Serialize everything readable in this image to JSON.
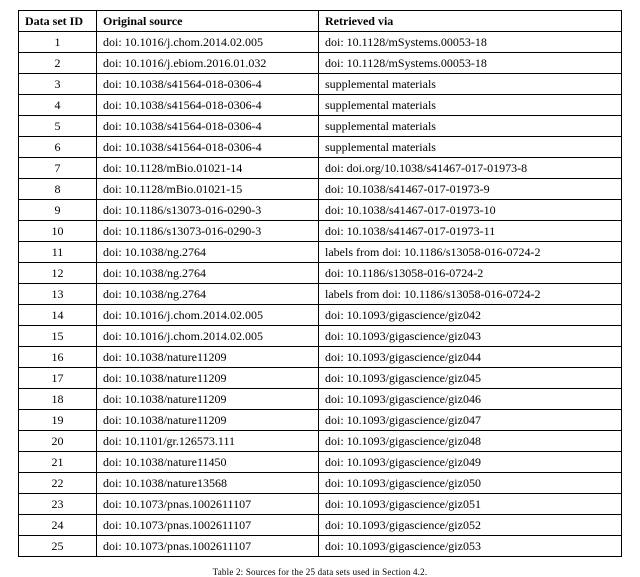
{
  "headers": {
    "id": "Data set ID",
    "src": "Original source",
    "via": "Retrieved via"
  },
  "rows": [
    {
      "id": "1",
      "src": "doi: 10.1016/j.chom.2014.02.005",
      "via": "doi: 10.1128/mSystems.00053-18"
    },
    {
      "id": "2",
      "src": "doi: 10.1016/j.ebiom.2016.01.032",
      "via": "doi: 10.1128/mSystems.00053-18"
    },
    {
      "id": "3",
      "src": "doi: 10.1038/s41564-018-0306-4",
      "via": "supplemental materials"
    },
    {
      "id": "4",
      "src": "doi: 10.1038/s41564-018-0306-4",
      "via": "supplemental materials"
    },
    {
      "id": "5",
      "src": "doi: 10.1038/s41564-018-0306-4",
      "via": "supplemental materials"
    },
    {
      "id": "6",
      "src": "doi: 10.1038/s41564-018-0306-4",
      "via": "supplemental materials"
    },
    {
      "id": "7",
      "src": "doi: 10.1128/mBio.01021-14",
      "via": "doi: doi.org/10.1038/s41467-017-01973-8"
    },
    {
      "id": "8",
      "src": "doi: 10.1128/mBio.01021-15",
      "via": "doi: 10.1038/s41467-017-01973-9"
    },
    {
      "id": "9",
      "src": "doi: 10.1186/s13073-016-0290-3",
      "via": "doi: 10.1038/s41467-017-01973-10"
    },
    {
      "id": "10",
      "src": "doi: 10.1186/s13073-016-0290-3",
      "via": "doi: 10.1038/s41467-017-01973-11"
    },
    {
      "id": "11",
      "src": "doi: 10.1038/ng.2764",
      "via": "labels from doi: 10.1186/s13058-016-0724-2"
    },
    {
      "id": "12",
      "src": "doi: 10.1038/ng.2764",
      "via": "doi: 10.1186/s13058-016-0724-2"
    },
    {
      "id": "13",
      "src": "doi: 10.1038/ng.2764",
      "via": "labels from doi: 10.1186/s13058-016-0724-2"
    },
    {
      "id": "14",
      "src": "doi: 10.1016/j.chom.2014.02.005",
      "via": "doi: 10.1093/gigascience/giz042"
    },
    {
      "id": "15",
      "src": "doi: 10.1016/j.chom.2014.02.005",
      "via": "doi: 10.1093/gigascience/giz043"
    },
    {
      "id": "16",
      "src": "doi: 10.1038/nature11209",
      "via": "doi: 10.1093/gigascience/giz044"
    },
    {
      "id": "17",
      "src": "doi: 10.1038/nature11209",
      "via": "doi: 10.1093/gigascience/giz045"
    },
    {
      "id": "18",
      "src": "doi: 10.1038/nature11209",
      "via": "doi: 10.1093/gigascience/giz046"
    },
    {
      "id": "19",
      "src": "doi: 10.1038/nature11209",
      "via": "doi: 10.1093/gigascience/giz047"
    },
    {
      "id": "20",
      "src": "doi: 10.1101/gr.126573.111",
      "via": "doi: 10.1093/gigascience/giz048"
    },
    {
      "id": "21",
      "src": "doi: 10.1038/nature11450",
      "via": "doi: 10.1093/gigascience/giz049"
    },
    {
      "id": "22",
      "src": "doi: 10.1038/nature13568",
      "via": "doi: 10.1093/gigascience/giz050"
    },
    {
      "id": "23",
      "src": "doi: 10.1073/pnas.1002611107",
      "via": "doi: 10.1093/gigascience/giz051"
    },
    {
      "id": "24",
      "src": "doi: 10.1073/pnas.1002611107",
      "via": "doi: 10.1093/gigascience/giz052"
    },
    {
      "id": "25",
      "src": "doi: 10.1073/pnas.1002611107",
      "via": "doi: 10.1093/gigascience/giz053"
    }
  ],
  "caption": "Table 2: Sources for the 25 data sets used in Section 4.2."
}
